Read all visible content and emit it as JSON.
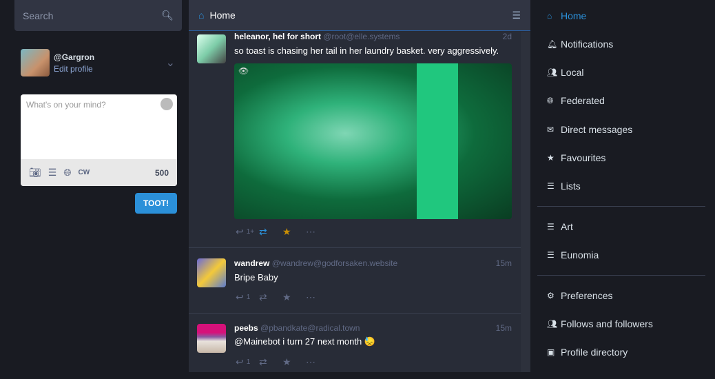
{
  "search": {
    "placeholder": "Search",
    "icon": "search-icon"
  },
  "profile": {
    "handle": "@Gargron",
    "edit": "Edit profile"
  },
  "compose": {
    "placeholder": "What's on your mind?",
    "cw": "CW",
    "count": "500",
    "toot": "TOOT!"
  },
  "column": {
    "title": "Home"
  },
  "statuses": [
    {
      "name": "heleanor, hel for short",
      "acct": "@root@elle.systems",
      "time": "2d",
      "text": "so toast is chasing her tail in her laundry basket. very aggressively.",
      "replies": "1+",
      "boosted": true,
      "favourited": true,
      "has_media": true
    },
    {
      "name": "wandrew",
      "acct": "@wandrew@godforsaken.website",
      "time": "15m",
      "text": "Bripe Baby",
      "replies": "1",
      "boosted": false,
      "favourited": false
    },
    {
      "name": "peebs",
      "acct": "@pbandkate@radical.town",
      "time": "15m",
      "text": "@Mainebot i turn 27 next month 😓",
      "replies": "1",
      "boosted": false,
      "favourited": false
    }
  ],
  "nav": {
    "items": [
      "Home",
      "Notifications",
      "Local",
      "Federated",
      "Direct messages",
      "Favourites",
      "Lists"
    ],
    "lists": [
      "Art",
      "Eunomia"
    ],
    "extra": [
      "Preferences",
      "Follows and followers",
      "Profile directory"
    ]
  },
  "colors": {
    "accent": "#2b90d9",
    "favourite": "#ca8f04",
    "background": "#191b22",
    "column": "#282c37"
  }
}
